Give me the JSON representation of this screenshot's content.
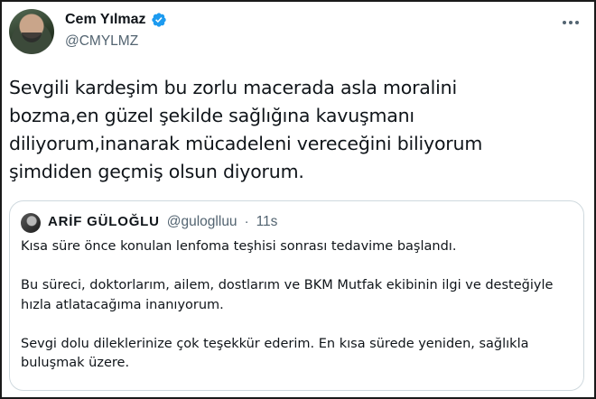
{
  "author": {
    "display_name": "Cem Yılmaz",
    "handle": "@CMYLMZ",
    "verified": true,
    "avatar_icon": "profile-photo"
  },
  "tweet": {
    "text": "Sevgili kardeşim bu zorlu macerada asla moralini\nbozma,en güzel şekilde sağlığına kavuşmanı\ndiliyorum,inanarak mücadeleni vereceğini biliyorum\nşimdiden geçmiş olsun diyorum."
  },
  "quoted": {
    "display_name": "ARİF GÜLOĞLU",
    "handle": "@guloglluu",
    "separator": "·",
    "time": "11s",
    "paragraphs": [
      "Kısa süre önce konulan lenfoma teşhisi sonrası tedavime başlandı.",
      "Bu süreci, doktorlarım, ailem, dostlarım ve BKM Mutfak ekibinin ilgi ve desteğiyle hızla atlatacağıma inanıyorum.",
      "Sevgi dolu dileklerinize çok teşekkür ederim. En kısa sürede yeniden, sağlıkla buluşmak üzere."
    ]
  },
  "colors": {
    "verified_blue": "#1d9bf0",
    "text_primary": "#0f1419",
    "text_secondary": "#536471",
    "border": "#cfd9de"
  },
  "icons": {
    "verified": "verified-badge-icon",
    "more": "more-options-icon"
  }
}
